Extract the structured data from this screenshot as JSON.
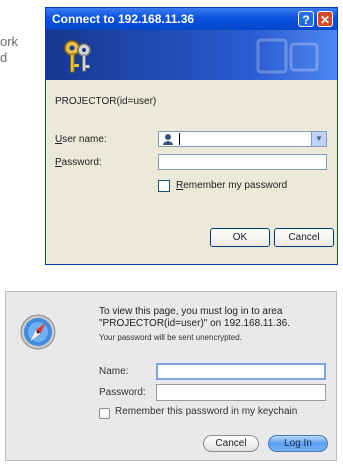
{
  "side_text": [
    "ork",
    "d"
  ],
  "windows_dialog": {
    "title": "Connect to 192.168.11.36",
    "help_glyph": "?",
    "close_glyph": "✕",
    "realm": "PROJECTOR(id=user)",
    "username_label_underlined": "U",
    "username_label_rest": "ser name:",
    "password_label_underlined": "P",
    "password_label_rest": "assword:",
    "username_value": "",
    "password_value": "",
    "remember_label_underlined": "R",
    "remember_label_rest": "emember my password",
    "remember_checked": false,
    "ok_label": "OK",
    "cancel_label": "Cancel",
    "icons": {
      "banner": "keys-icon",
      "user": "user-icon",
      "dropdown": "chevron-down-icon"
    },
    "colors": {
      "titlebar": "#0a52de",
      "close": "#d24a2a",
      "face": "#ece9d8"
    }
  },
  "mac_dialog": {
    "message_line1": "To view this page, you must log in to area",
    "message_line2": "\"PROJECTOR(id=user)\" on 192.168.11.36.",
    "subtext": "Your password will be sent unencrypted.",
    "name_label": "Name:",
    "password_label": "Password:",
    "name_value": "",
    "password_value": "",
    "remember_label": "Remember this password in my keychain",
    "remember_checked": false,
    "cancel_label": "Cancel",
    "login_label": "Log In",
    "icons": {
      "app": "compass-icon"
    },
    "colors": {
      "login": "#5ba0ef",
      "focus_ring": "#7ba5e3"
    }
  }
}
